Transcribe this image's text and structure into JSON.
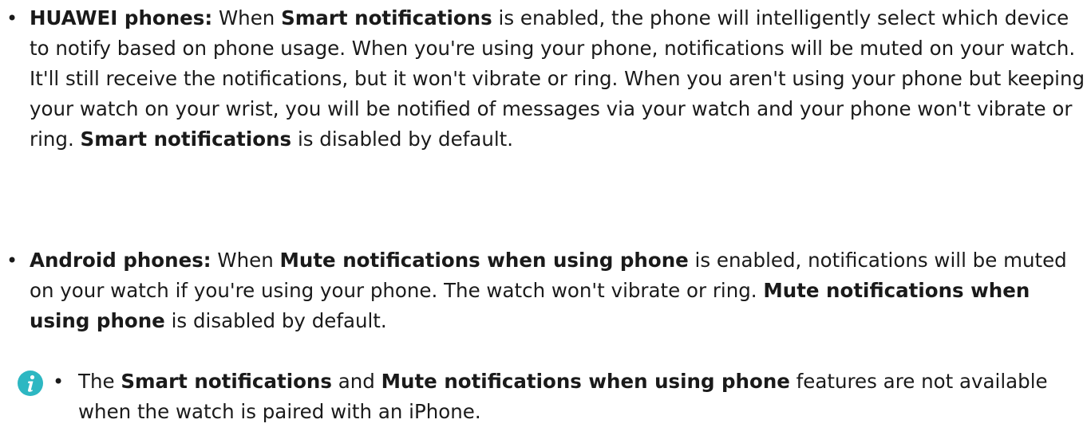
{
  "bullet_char": "•",
  "item1": {
    "lead": "HUAWEI phones:",
    "t1": " When ",
    "b1": "Smart notifications",
    "t2": " is enabled, the phone will intelligently select which device to notify based on phone usage. When you're using your phone, notifications will be muted on your watch. It'll still receive the notifications, but it won't vibrate or ring. When you aren't using your phone but keeping your watch on your wrist, you will be notified of messages via your watch and your phone won't vibrate or ring. ",
    "b2": "Smart notifications",
    "t3": " is disabled by default."
  },
  "item2": {
    "lead": "Android phones:",
    "t1": " When ",
    "b1": "Mute notifications when using phone",
    "t2": " is enabled, notifications will be muted on your watch if you're using your phone. The watch won't vibrate or ring. ",
    "b2": "Mute notifications when using phone",
    "t3": " is disabled by default."
  },
  "note": {
    "icon": "info-icon",
    "icon_color": "#2db7c2",
    "t1": "The ",
    "b1": "Smart notifications",
    "t2": " and ",
    "b2": "Mute notifications when using phone",
    "t3": " features are not available when the watch is paired with an iPhone."
  }
}
